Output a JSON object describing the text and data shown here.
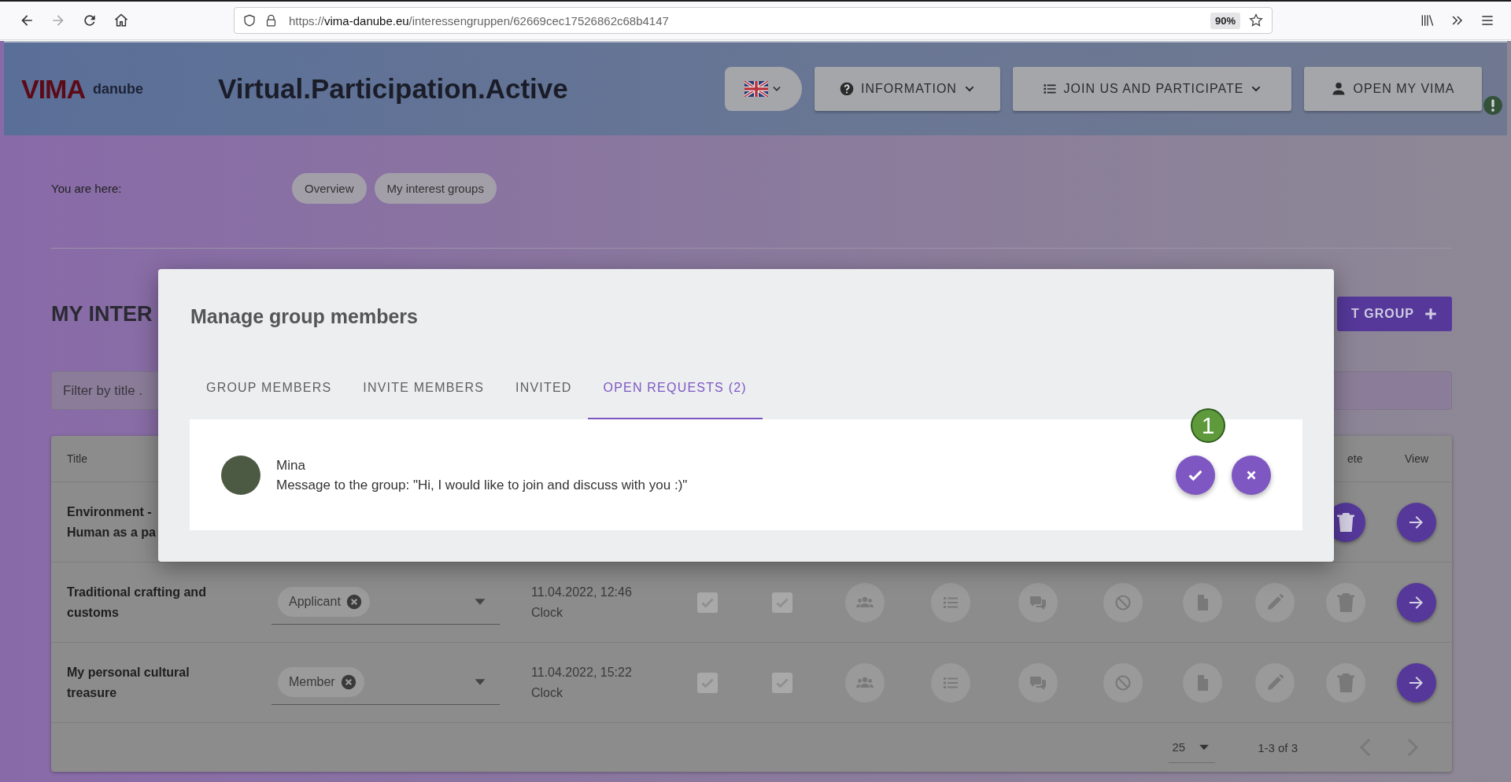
{
  "browser": {
    "url": "https://**vima-danube.eu**/interessengruppen/62669cec17526862c68b4147",
    "zoom": "90%",
    "forward_disabled": true
  },
  "header": {
    "logo": {
      "mark": "VIMA",
      "word": "danube"
    },
    "title": "Virtual.Participation.Active",
    "menus": [
      {
        "label": "INFORMATION",
        "kind": "question",
        "has_dropdown": true
      },
      {
        "label": "JOIN US AND PARTICIPATE",
        "kind": "list",
        "has_dropdown": true
      },
      {
        "label": "OPEN MY VIMA",
        "kind": "person",
        "has_dropdown": false
      }
    ]
  },
  "breadcrumb": {
    "label": "You are here:",
    "items": [
      "Overview",
      "My interest groups"
    ]
  },
  "heading": "MY INTER",
  "add_button": "T GROUP",
  "filter": {
    "placeholder": "Filter by title ."
  },
  "table": {
    "columns": [
      {
        "kind": "title",
        "label": "Title"
      },
      {
        "kind": "delete",
        "label": "ete"
      },
      {
        "kind": "view",
        "label": "View"
      }
    ],
    "rows": [
      {
        "title_lines": [
          "Environment -",
          "Human as a pa"
        ],
        "actions": [
          {
            "kind": "delete",
            "disabled": false
          },
          {
            "kind": "view",
            "disabled": false
          }
        ]
      },
      {
        "title_lines": [
          "Traditional crafting and",
          "customs"
        ],
        "role": "Applicant",
        "date_lines": [
          "11.04.2022, 12:46",
          "Clock"
        ],
        "checkboxes": [
          {
            "checked": true
          },
          {
            "checked": true
          }
        ],
        "actions": [
          {
            "kind": "members",
            "disabled": true
          },
          {
            "kind": "list",
            "disabled": true
          },
          {
            "kind": "chat",
            "disabled": true
          },
          {
            "kind": "block",
            "disabled": true
          },
          {
            "kind": "document",
            "disabled": true
          },
          {
            "kind": "edit",
            "disabled": true
          },
          {
            "kind": "delete",
            "disabled": true
          },
          {
            "kind": "view",
            "disabled": false
          }
        ]
      },
      {
        "title_lines": [
          "My personal cultural",
          "treasure"
        ],
        "role": "Member",
        "date_lines": [
          "11.04.2022, 15:22",
          "Clock"
        ],
        "checkboxes": [
          {
            "checked": true
          },
          {
            "checked": true
          }
        ],
        "actions": [
          {
            "kind": "members",
            "disabled": true
          },
          {
            "kind": "list",
            "disabled": true
          },
          {
            "kind": "chat",
            "disabled": true
          },
          {
            "kind": "block",
            "disabled": true
          },
          {
            "kind": "document",
            "disabled": true
          },
          {
            "kind": "edit",
            "disabled": true
          },
          {
            "kind": "delete",
            "disabled": true
          },
          {
            "kind": "view",
            "disabled": false
          }
        ]
      }
    ],
    "pagination": {
      "page_size": "25",
      "range": "1-3 of 3",
      "prev_disabled": true,
      "next_disabled": true
    }
  },
  "dialog": {
    "title": "Manage group members",
    "tabs": [
      {
        "label": "GROUP MEMBERS",
        "selected": false
      },
      {
        "label": "INVITE MEMBERS",
        "selected": false
      },
      {
        "label": "INVITED",
        "selected": false
      },
      {
        "label": "OPEN REQUESTS (2)",
        "selected": true
      }
    ],
    "requests": [
      {
        "name": "Mina",
        "message": "Message to the group: \"Hi, I would like to join and discuss with you :)\""
      }
    ],
    "marker": "1"
  }
}
